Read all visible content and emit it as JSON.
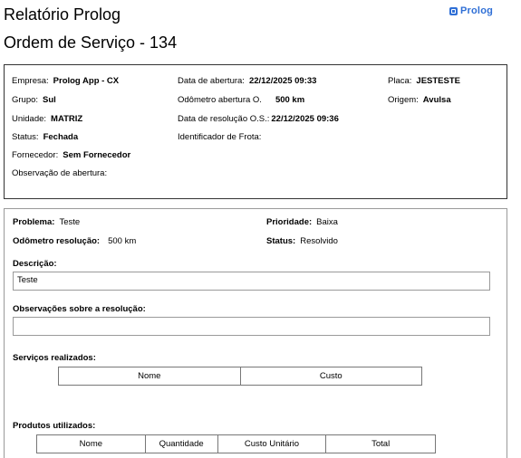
{
  "header": {
    "title": "Relatório Prolog",
    "subtitle": "Ordem de Serviço - 134",
    "logo_text": "Prolog",
    "brand_color": "#2f6fd6"
  },
  "info": {
    "empresa_label": "Empresa:",
    "empresa": "Prolog App - CX",
    "grupo_label": "Grupo:",
    "grupo": "Sul",
    "unidade_label": "Unidade:",
    "unidade": "MATRIZ",
    "status_label": "Status:",
    "status": "Fechada",
    "fornecedor_label": "Fornecedor:",
    "fornecedor": "Sem Fornecedor",
    "obs_abertura_label": "Observação de abertura:",
    "data_abertura_label": "Data de abertura:",
    "data_abertura": "22/12/2025 09:33",
    "odometro_abertura_label": "Odômetro abertura O.",
    "odometro_abertura": "500 km",
    "data_resolucao_label": "Data de resolução O.S.:",
    "data_resolucao": "22/12/2025 09:36",
    "identificador_frota_label": "Identificador de Frota:",
    "placa_label": "Placa:",
    "placa": "JESTESTE",
    "origem_label": "Origem:",
    "origem": "Avulsa"
  },
  "item": {
    "problema_label": "Problema:",
    "problema": "Teste",
    "prioridade_label": "Prioridade:",
    "prioridade": "Baixa",
    "odometro_resolucao_label": "Odômetro resolução:",
    "odometro_resolucao": "500 km",
    "status_label": "Status:",
    "status": "Resolvido",
    "descricao_label": "Descrição:",
    "descricao": "Teste",
    "observacoes_label": "Observações sobre a resolução:",
    "observacoes": "",
    "servicos_label": "Serviços realizados:",
    "servicos_columns": [
      "Nome",
      "Custo"
    ],
    "produtos_label": "Produtos utilizados:",
    "produtos_columns": [
      "Nome",
      "Quantidade",
      "Custo Unitário",
      "Total"
    ]
  }
}
